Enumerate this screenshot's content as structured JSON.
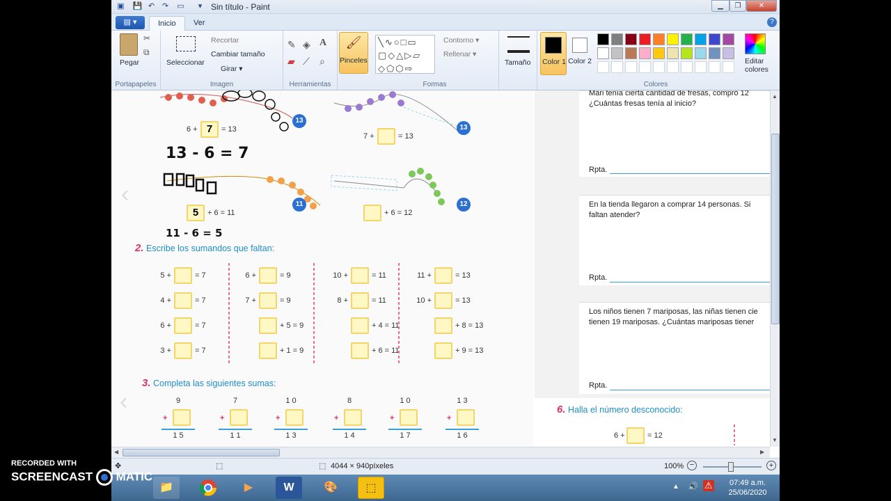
{
  "window": {
    "title": "Sin título - Paint",
    "minimize": "▁",
    "maximize": "❐",
    "close": "✕"
  },
  "tabs": {
    "file": "▤ ▾",
    "items": [
      "Inicio",
      "Ver"
    ],
    "help": "?"
  },
  "ribbon": {
    "clipboard": {
      "paste": "Pegar",
      "caption": "Portapapeles"
    },
    "image": {
      "select": "Seleccionar",
      "crop": "Recortar",
      "resize": "Cambiar tamaño",
      "rotate": "Girar ▾",
      "caption": "Imagen"
    },
    "tools": {
      "caption": "Herramientas"
    },
    "brushes": {
      "label": "Pinceles"
    },
    "shapes": {
      "outline": "Contorno ▾",
      "fill": "Rellenar ▾",
      "caption": "Formas"
    },
    "size": {
      "label": "Tamaño"
    },
    "color1": {
      "label": "Color 1"
    },
    "color2": {
      "label": "Color 2"
    },
    "colors": {
      "caption": "Colores",
      "edit": "Editar colores",
      "row1": [
        "#000000",
        "#7f7f7f",
        "#880015",
        "#ed1c24",
        "#ff7f27",
        "#fff200",
        "#22b14c",
        "#00a2e8",
        "#3f48cc",
        "#a349a4"
      ],
      "row2": [
        "#ffffff",
        "#c3c3c3",
        "#b97a57",
        "#ffaec9",
        "#ffc90e",
        "#efe4b0",
        "#b5e61d",
        "#99d9ea",
        "#7092be",
        "#c8bfe7"
      ]
    }
  },
  "worksheet": {
    "top_eqs": [
      {
        "left": "6 +",
        "box": "7",
        "right": "= 13",
        "circle": "13"
      },
      {
        "left": "7 +",
        "box": "",
        "right": "= 13",
        "circle": "13"
      },
      {
        "left": "",
        "box": "5",
        "right": "+ 6 = 11",
        "circle": "11"
      },
      {
        "left": "",
        "box": "",
        "right": "+ 6 = 12",
        "circle": "12"
      }
    ],
    "hand1": "13 - 6 = 7",
    "hand2": "11 - 6 = 5",
    "sec2_num": "2.",
    "sec2_title": "Escribe los sumandos que faltan:",
    "sec2_rows": [
      [
        "5 +|= 7",
        "6 +|= 9",
        "10 +|= 11",
        "11 +|= 13"
      ],
      [
        "4 +|= 7",
        "7 +|= 9",
        "8 +|= 11",
        "10 +|= 13"
      ],
      [
        "6 +|= 7",
        "|+ 5 = 9",
        "|+ 4 = 11",
        "|+ 8 = 13"
      ],
      [
        "3 +|= 7",
        "|+ 1 = 9",
        "|+ 6 = 11",
        "|+ 9 = 13"
      ]
    ],
    "sec3_num": "3.",
    "sec3_title": "Completa las siguientes sumas:",
    "sums": [
      {
        "top": "9",
        "bottom": "1 5"
      },
      {
        "top": "7",
        "bottom": "1 1"
      },
      {
        "top": "1 0",
        "bottom": "1 3"
      },
      {
        "top": "8",
        "bottom": "1 4"
      },
      {
        "top": "1 0",
        "bottom": "1 7"
      },
      {
        "top": "1 3",
        "bottom": "1 6"
      }
    ],
    "q1": "Mari tenía cierta cantidad de fresas, compró 12\n¿Cuántas fresas tenía al inicio?",
    "q2": "En la tienda llegaron a comprar 14 personas. Si\nfaltan atender?",
    "q3": "Los niños tienen 7 mariposas, las niñas tienen cie\ntienen 19 mariposas. ¿Cuántas mariposas tiener",
    "rpta": "Rpta.",
    "sec6_num": "6.",
    "sec6_title": "Halla el número desconocido:",
    "sec6_eq_left": "6 +",
    "sec6_eq_right": "= 12"
  },
  "status": {
    "dimensions": "4044 × 940píxeles",
    "zoom": "100%"
  },
  "taskbar": {
    "time": "07:49 a.m.",
    "date": "25/06/2020"
  },
  "watermark": {
    "line1": "RECORDED WITH",
    "line2": "SCREENCAST",
    "line3": "MATIC"
  }
}
